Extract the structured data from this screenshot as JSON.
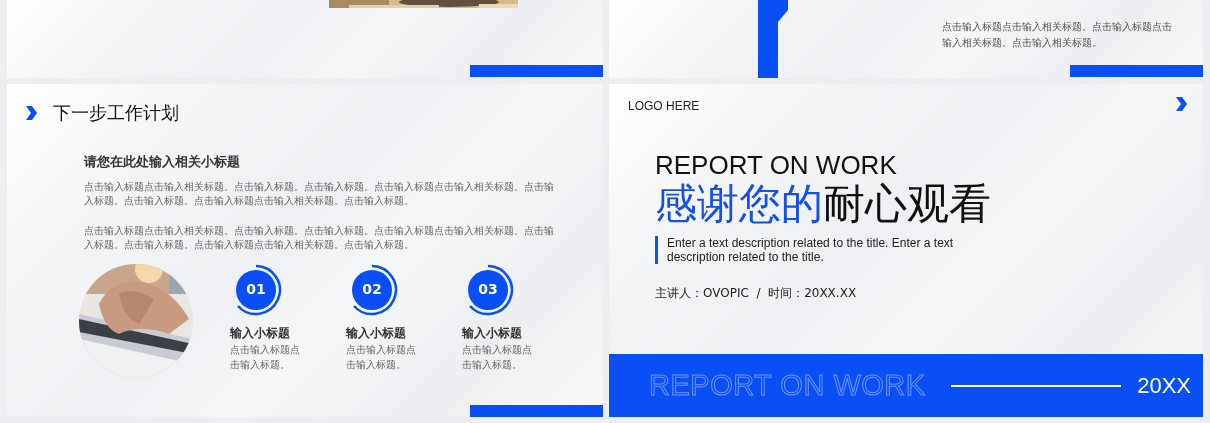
{
  "slides": [
    {
      "kind": "cut_picture",
      "picture": {
        "kind": "picture"
      }
    },
    {
      "kind": "cut_text",
      "text": "点击输入标题点击输入相关标题。点击输入标题点击输入相关标题。点击输入相关标题。"
    },
    {
      "kind": "plan",
      "title": "下一步工作计划",
      "subtitle": "请您在此处输入相关小标题",
      "paragraphs": [
        "点击输入标题点击输入相关标题。点击输入标题。点击输入标题。点击输入标题点击输入相关标题。点击输入标题。点击输入标题。点击输入标题点击输入相关标题。点击输入标题。",
        "点击输入标题点击输入相关标题。点击输入标题。点击输入标题。点击输入标题点击输入相关标题。点击输入标题。点击输入标题。点击输入标题点击输入相关标题。点击输入标题。"
      ],
      "picture": {
        "kind": "picture"
      },
      "steps": [
        {
          "number": "01",
          "title": "输入小标题",
          "text": "点击输入标题点击输入标题。"
        },
        {
          "number": "02",
          "title": "输入小标题",
          "text": "点击输入标题点击输入标题。"
        },
        {
          "number": "03",
          "title": "输入小标题",
          "text": "点击输入标题点击输入标题。"
        }
      ]
    },
    {
      "kind": "ending",
      "logo": "LOGO HERE",
      "heading": "REPORT ON WORK",
      "title_highlight": "感谢您的",
      "title_rest": "耐心观看",
      "description": "Enter a text description related to the title. Enter a text description related to the title.",
      "presenter": "主讲人：OVOPIC  /  时间：20XX.XX",
      "footer_outline": "REPORT ON WORK",
      "footer_year": "20XX"
    }
  ]
}
